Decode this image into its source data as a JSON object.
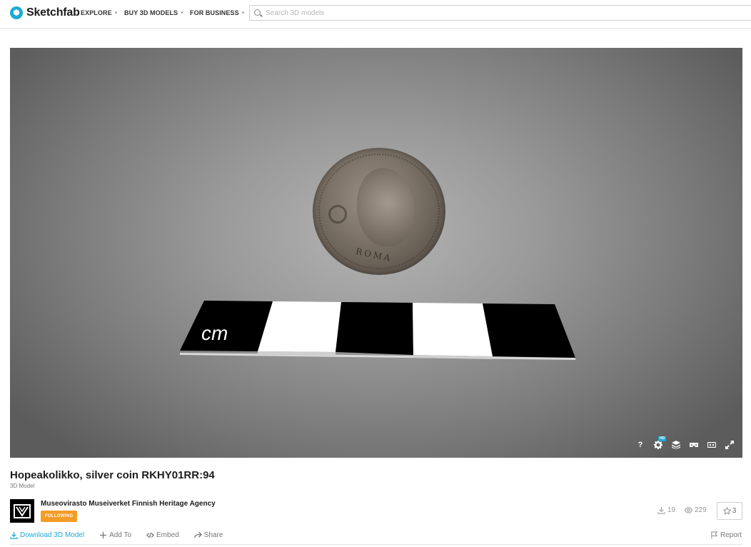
{
  "header": {
    "logo_text": "Sketchfab",
    "nav": [
      {
        "label": "EXPLORE"
      },
      {
        "label": "BUY 3D MODELS"
      },
      {
        "label": "FOR BUSINESS"
      }
    ],
    "search_placeholder": "Search 3D models"
  },
  "viewer": {
    "scale_label": "cm",
    "coin_inscription": "ROMA",
    "controls": [
      {
        "name": "help-icon",
        "glyph": "?"
      },
      {
        "name": "settings-icon",
        "badge": "HD"
      },
      {
        "name": "layers-icon"
      },
      {
        "name": "vr-icon"
      },
      {
        "name": "ar-icon"
      },
      {
        "name": "fullscreen-icon"
      }
    ]
  },
  "model": {
    "title": "Hopeakolikko, silver coin RKHY01RR:94",
    "type": "3D Model"
  },
  "owner": {
    "name": "Museovirasto Museiverket Finnish Heritage Agency",
    "follow_label": "FOLLOWING"
  },
  "stats": {
    "downloads": "19",
    "views": "229",
    "likes": "3"
  },
  "actions": {
    "download": "Download 3D Model",
    "add_to": "Add To",
    "embed": "Embed",
    "share": "Share",
    "report": "Report"
  },
  "colors": {
    "accent": "#1caad9",
    "follow": "#f39c26"
  }
}
